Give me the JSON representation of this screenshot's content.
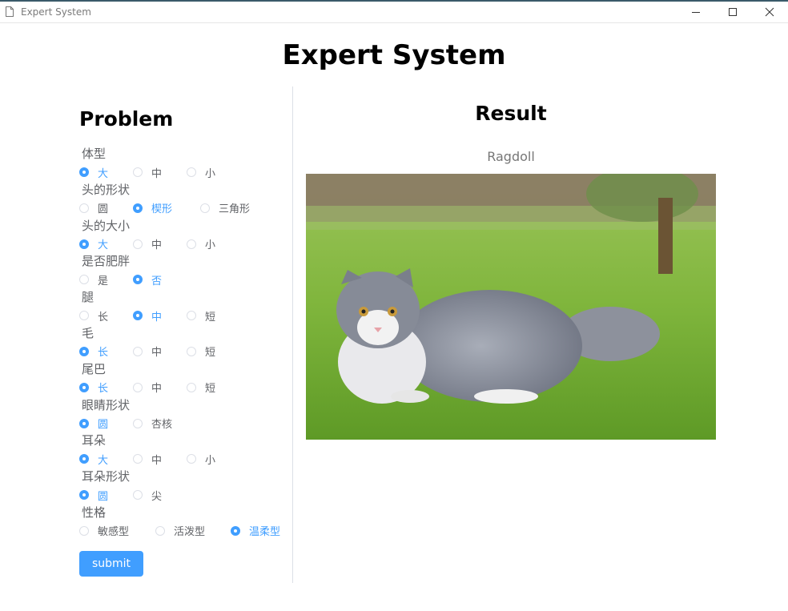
{
  "window": {
    "title": "Expert System"
  },
  "header": {
    "title": "Expert System"
  },
  "problem": {
    "title": "Problem",
    "questions": [
      {
        "label": "体型",
        "options": [
          "大",
          "中",
          "小"
        ],
        "selected": 0
      },
      {
        "label": "头的形状",
        "options": [
          "圆",
          "楔形",
          "三角形"
        ],
        "selected": 1
      },
      {
        "label": "头的大小",
        "options": [
          "大",
          "中",
          "小"
        ],
        "selected": 0
      },
      {
        "label": "是否肥胖",
        "options": [
          "是",
          "否"
        ],
        "selected": 1
      },
      {
        "label": "腿",
        "options": [
          "长",
          "中",
          "短"
        ],
        "selected": 1
      },
      {
        "label": "毛",
        "options": [
          "长",
          "中",
          "短"
        ],
        "selected": 0
      },
      {
        "label": "尾巴",
        "options": [
          "长",
          "中",
          "短"
        ],
        "selected": 0
      },
      {
        "label": "眼睛形状",
        "options": [
          "圆",
          "杏核"
        ],
        "selected": 0
      },
      {
        "label": "耳朵",
        "options": [
          "大",
          "中",
          "小"
        ],
        "selected": 0
      },
      {
        "label": "耳朵形状",
        "options": [
          "圆",
          "尖"
        ],
        "selected": 0
      },
      {
        "label": "性格",
        "options": [
          "敏感型",
          "活泼型",
          "温柔型"
        ],
        "selected": 2
      }
    ],
    "submit_label": "submit"
  },
  "result": {
    "title": "Result",
    "breed": "Ragdoll"
  },
  "colors": {
    "accent": "#409eff",
    "border": "#dcdfe6"
  }
}
